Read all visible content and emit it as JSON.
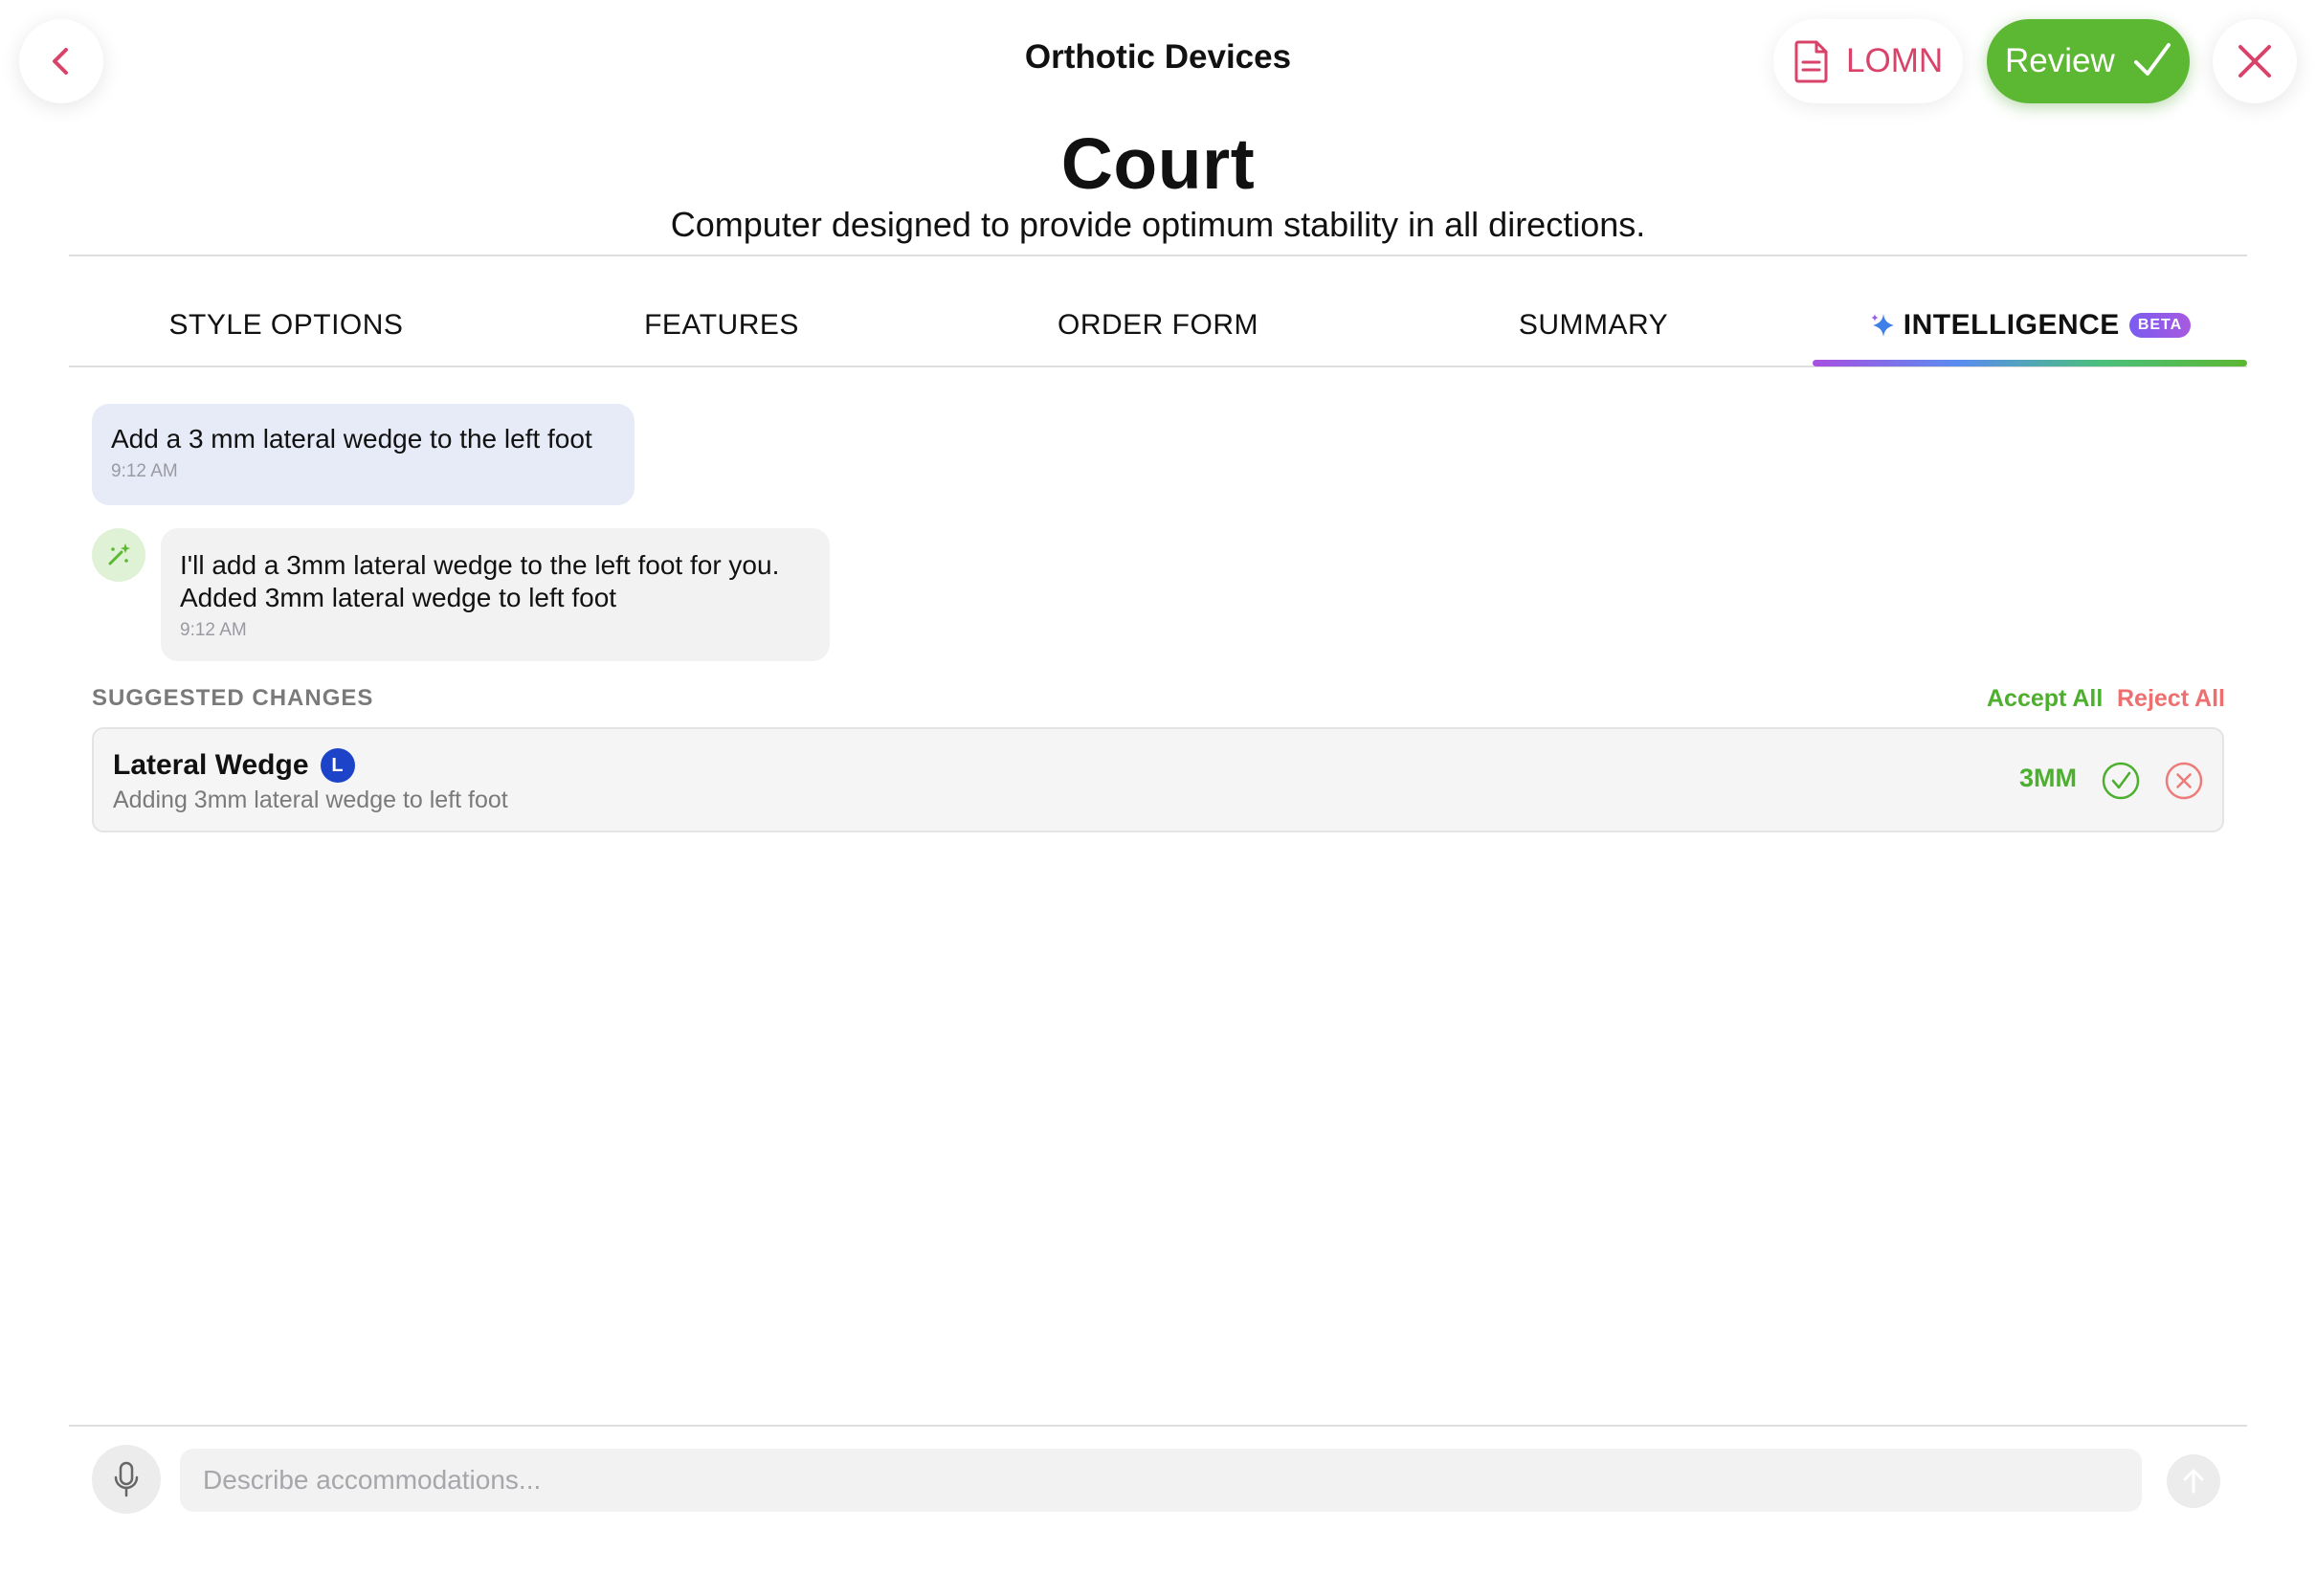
{
  "header": {
    "app_title": "Orthotic Devices",
    "lomn_label": "LOMN",
    "review_label": "Review",
    "back_icon": "chevron-left-icon",
    "close_icon": "close-icon"
  },
  "device": {
    "name": "Court",
    "description": "Computer designed to provide optimum stability in all directions."
  },
  "tabs": [
    {
      "label": "STYLE OPTIONS"
    },
    {
      "label": "FEATURES"
    },
    {
      "label": "ORDER FORM"
    },
    {
      "label": "SUMMARY"
    },
    {
      "label": "INTELLIGENCE",
      "badge": "BETA",
      "active": true
    }
  ],
  "chat": {
    "messages": [
      {
        "role": "user",
        "text": "Add a 3 mm lateral wedge to the left foot",
        "time": "9:12 AM"
      },
      {
        "role": "assistant",
        "text_line1": "I'll add a 3mm lateral wedge to the left foot for you.",
        "text_line2": "Added 3mm lateral wedge to left foot",
        "time": "9:12 AM"
      }
    ]
  },
  "suggestions": {
    "heading": "SUGGESTED CHANGES",
    "accept_all": "Accept All",
    "reject_all": "Reject All",
    "items": [
      {
        "title": "Lateral Wedge",
        "side": "L",
        "description": "Adding 3mm lateral wedge to left foot",
        "value": "3MM"
      }
    ]
  },
  "composer": {
    "placeholder": "Describe accommodations..."
  },
  "colors": {
    "accent_pink": "#d9436a",
    "review_green": "#5cb832",
    "side_badge_blue": "#1d43c9",
    "reject_red": "#ee6f6f"
  }
}
